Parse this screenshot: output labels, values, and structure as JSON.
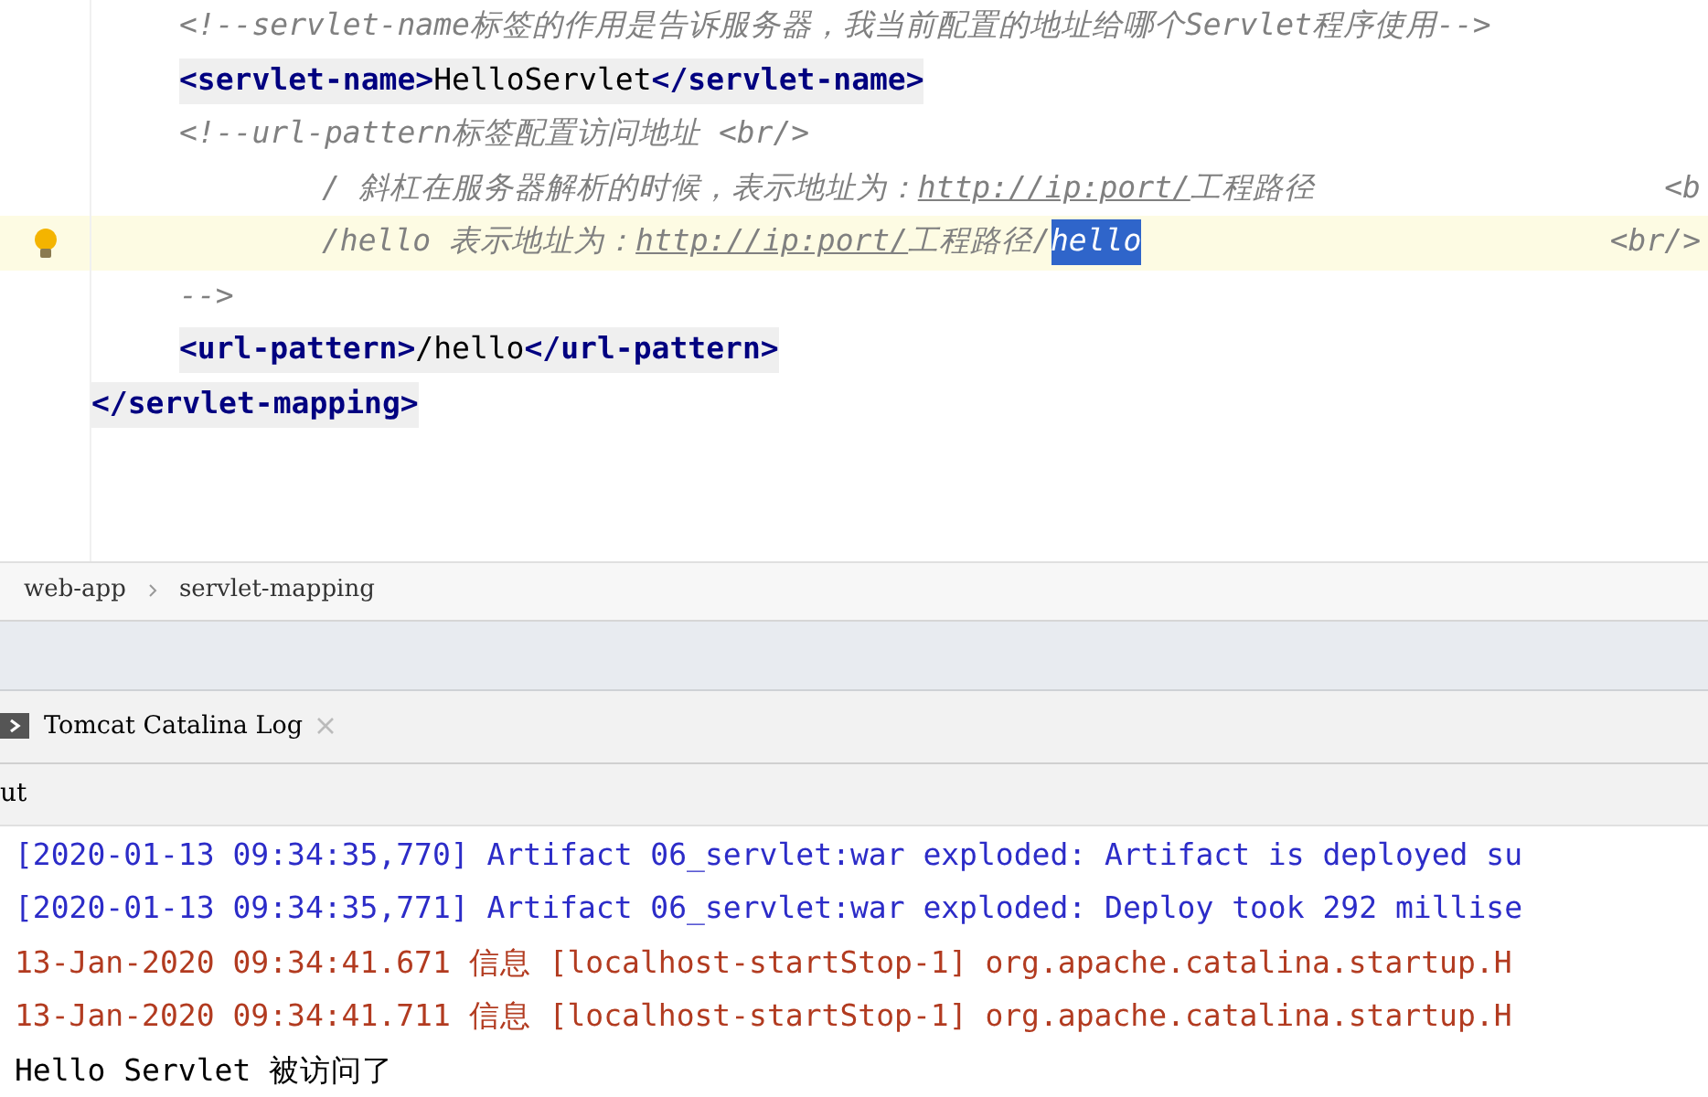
{
  "editor": {
    "lines": [
      {
        "kind": "inner",
        "current": false,
        "segments": [
          {
            "kind": "comment",
            "text": "<!--servlet-name标签的作用是告诉服务器，我当前配置的地址给哪个Servlet程序使用-->"
          }
        ]
      },
      {
        "kind": "inner",
        "current": false,
        "segments": [
          {
            "kind": "tag",
            "text": "<servlet-name>"
          },
          {
            "kind": "text",
            "text": "HelloServlet"
          },
          {
            "kind": "tag",
            "text": "</servlet-name>"
          }
        ]
      },
      {
        "kind": "inner",
        "current": false,
        "segments": [
          {
            "kind": "comment",
            "text": "<!--url-pattern标签配置访问地址 <br/>"
          }
        ]
      },
      {
        "kind": "continued",
        "current": false,
        "segments": [
          {
            "kind": "comment",
            "text": "/ 斜杠在服务器解析的时候，表示地址为："
          },
          {
            "kind": "link",
            "text": "http://ip:port/"
          },
          {
            "kind": "comment",
            "text": "工程路径"
          },
          {
            "kind": "trailing",
            "text": "<b"
          }
        ]
      },
      {
        "kind": "continued",
        "current": true,
        "segments": [
          {
            "kind": "comment",
            "text": "/hello 表示地址为："
          },
          {
            "kind": "link",
            "text": "http://ip:port/"
          },
          {
            "kind": "comment",
            "text": "工程路径/"
          },
          {
            "kind": "selection",
            "text": "hello"
          },
          {
            "kind": "trailing",
            "text": "<br/>"
          }
        ]
      },
      {
        "kind": "inner",
        "current": false,
        "segments": [
          {
            "kind": "comment",
            "text": "-->"
          }
        ]
      },
      {
        "kind": "inner",
        "current": false,
        "segments": [
          {
            "kind": "tag",
            "text": "<url-pattern>"
          },
          {
            "kind": "text",
            "text": "/hello"
          },
          {
            "kind": "tag",
            "text": "</url-pattern>"
          }
        ]
      },
      {
        "kind": "outer",
        "current": false,
        "segments": [
          {
            "kind": "tag",
            "text": "</servlet-mapping>"
          }
        ]
      }
    ]
  },
  "breadcrumb": [
    "web-app",
    "servlet-mapping"
  ],
  "tool_tab": {
    "label": "Tomcat Catalina Log"
  },
  "output_label": "ut",
  "log": [
    {
      "kind": "artifact",
      "text": "[2020-01-13 09:34:35,770] Artifact 06_servlet:war exploded: Artifact is deployed su"
    },
    {
      "kind": "artifact",
      "text": "[2020-01-13 09:34:35,771] Artifact 06_servlet:war exploded: Deploy took 292 millise"
    },
    {
      "kind": "info",
      "text": "13-Jan-2020 09:34:41.671 信息 [localhost-startStop-1] org.apache.catalina.startup.H"
    },
    {
      "kind": "info",
      "text": "13-Jan-2020 09:34:41.711 信息 [localhost-startStop-1] org.apache.catalina.startup.H"
    },
    {
      "kind": "stdout",
      "text": "Hello Servlet 被访问了"
    }
  ]
}
